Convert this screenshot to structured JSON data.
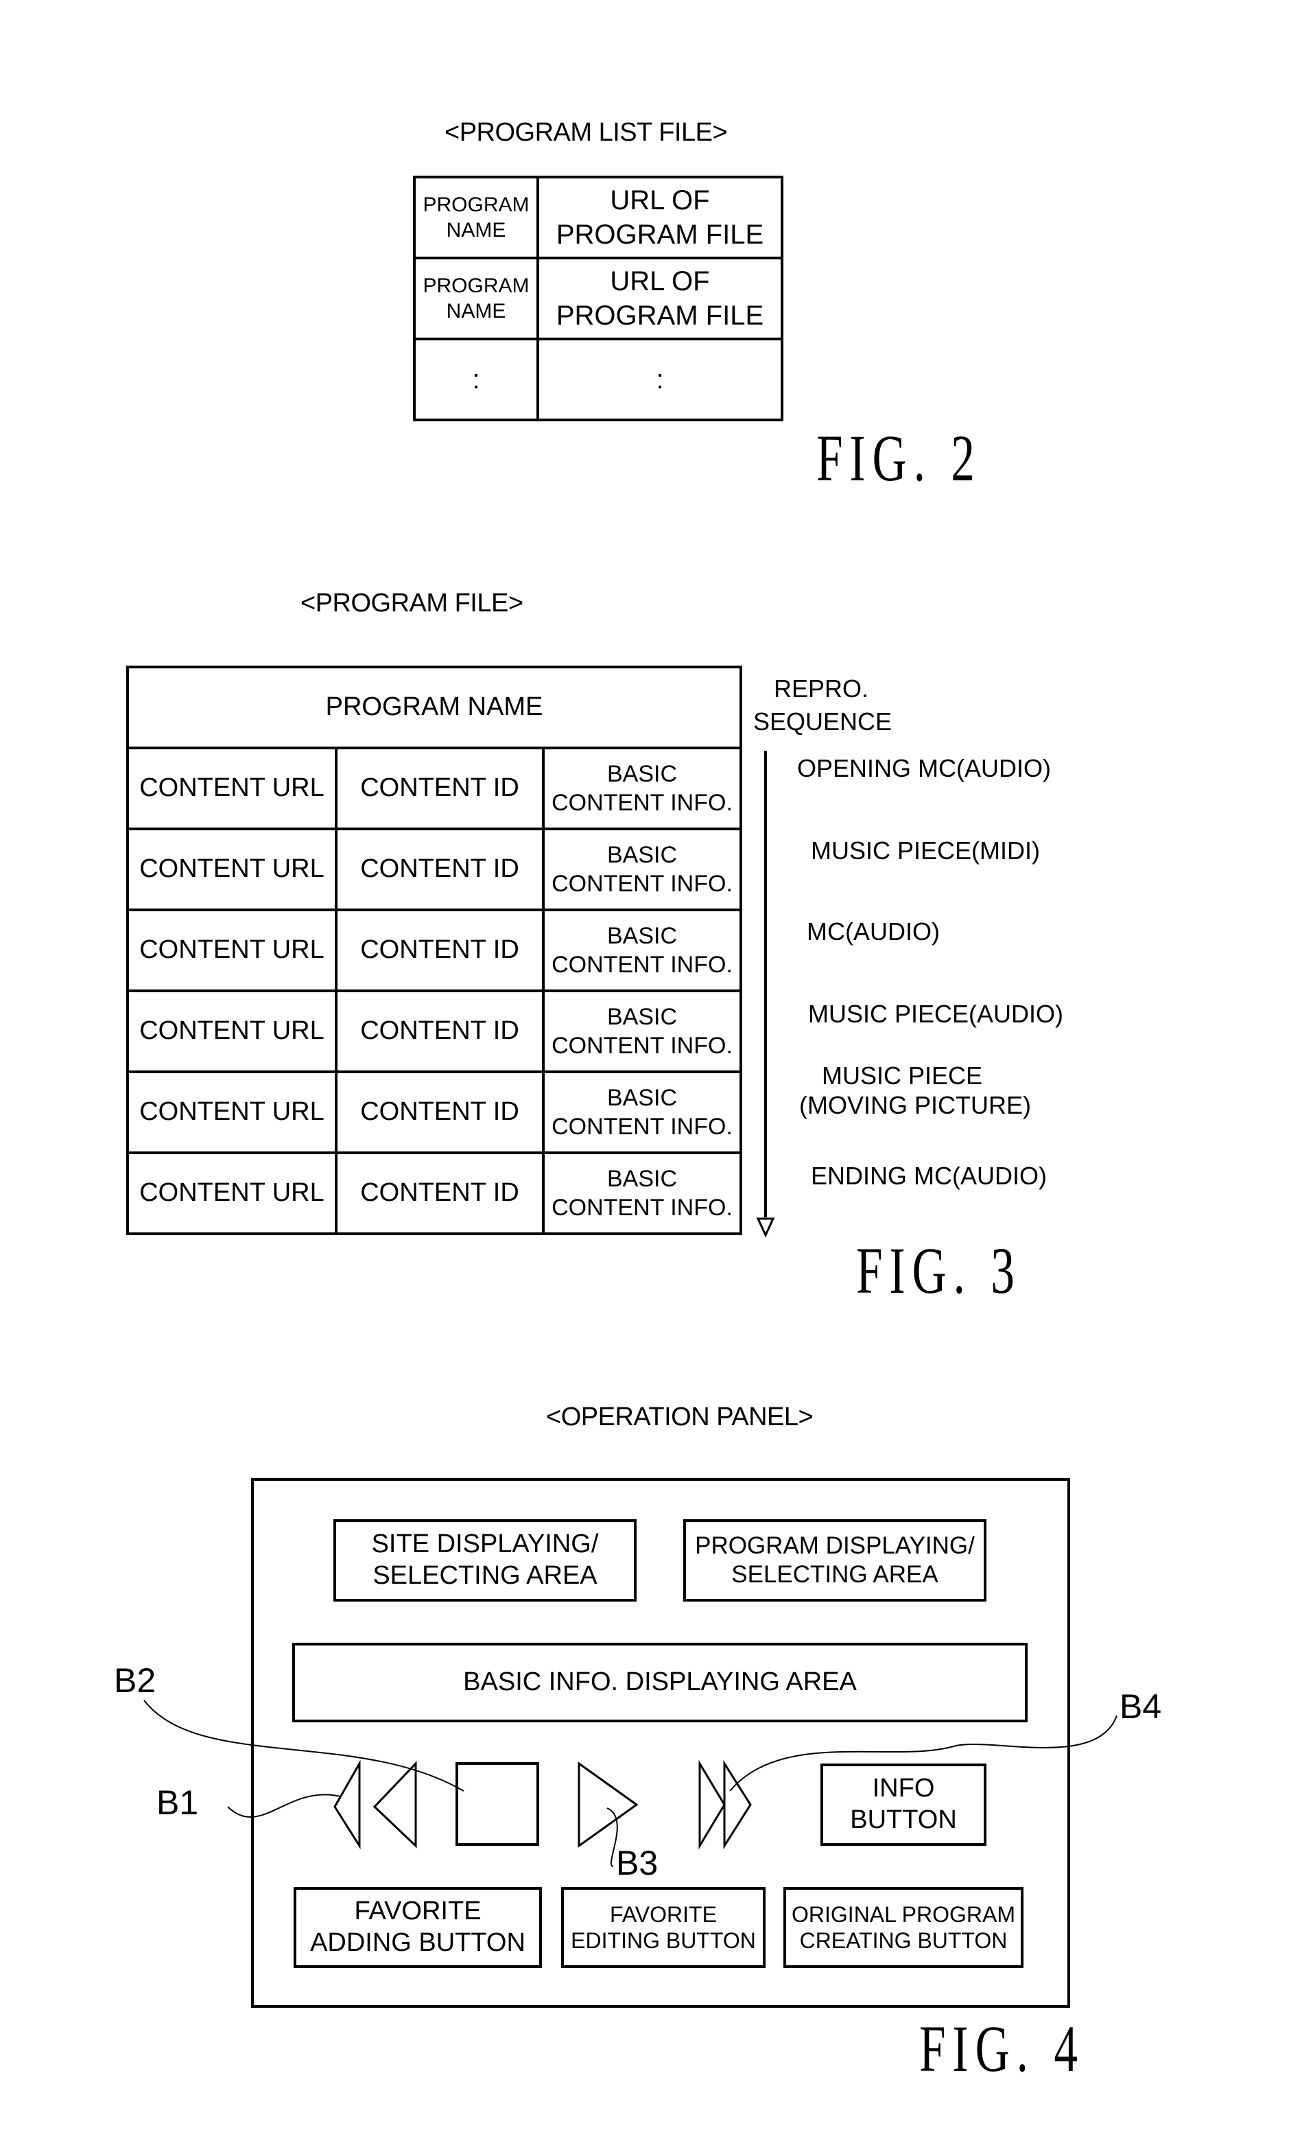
{
  "fig2": {
    "caption": "<PROGRAM LIST FILE>",
    "label": "FIG. 2",
    "rows": [
      {
        "name": "PROGRAM NAME",
        "url": "URL OF PROGRAM FILE"
      },
      {
        "name": "PROGRAM NAME",
        "url": "URL OF PROGRAM FILE"
      },
      {
        "name": ":",
        "url": ":"
      }
    ]
  },
  "fig3": {
    "caption": "<PROGRAM FILE>",
    "label": "FIG. 3",
    "header": "PROGRAM NAME",
    "rows": [
      {
        "url": "CONTENT URL",
        "id": "CONTENT ID",
        "info_line1": "BASIC",
        "info_line2": "CONTENT INFO."
      },
      {
        "url": "CONTENT URL",
        "id": "CONTENT ID",
        "info_line1": "BASIC",
        "info_line2": "CONTENT INFO."
      },
      {
        "url": "CONTENT URL",
        "id": "CONTENT ID",
        "info_line1": "BASIC",
        "info_line2": "CONTENT INFO."
      },
      {
        "url": "CONTENT URL",
        "id": "CONTENT ID",
        "info_line1": "BASIC",
        "info_line2": "CONTENT INFO."
      },
      {
        "url": "CONTENT URL",
        "id": "CONTENT ID",
        "info_line1": "BASIC",
        "info_line2": "CONTENT INFO."
      },
      {
        "url": "CONTENT URL",
        "id": "CONTENT ID",
        "info_line1": "BASIC",
        "info_line2": "CONTENT INFO."
      }
    ],
    "sequence_title_line1": "REPRO.",
    "sequence_title_line2": "SEQUENCE",
    "sequence": [
      {
        "line1": "OPENING MC(AUDIO)",
        "line2": ""
      },
      {
        "line1": "MUSIC PIECE(MIDI)",
        "line2": ""
      },
      {
        "line1": "MC(AUDIO)",
        "line2": ""
      },
      {
        "line1": "MUSIC PIECE(AUDIO)",
        "line2": ""
      },
      {
        "line1": "MUSIC PIECE",
        "line2": "(MOVING PICTURE)"
      },
      {
        "line1": "ENDING MC(AUDIO)",
        "line2": ""
      }
    ]
  },
  "fig4": {
    "caption": "<OPERATION PANEL>",
    "label": "FIG. 4",
    "site_area": {
      "line1": "SITE DISPLAYING/",
      "line2": "SELECTING AREA"
    },
    "program_area": {
      "line1": "PROGRAM DISPLAYING/",
      "line2": "SELECTING AREA"
    },
    "basic_info_area": "BASIC INFO. DISPLAYING AREA",
    "info_button": {
      "line1": "INFO",
      "line2": "BUTTON"
    },
    "favorite_adding_button": {
      "line1": "FAVORITE",
      "line2": "ADDING BUTTON"
    },
    "favorite_editing_button": {
      "line1": "FAVORITE",
      "line2": "EDITING BUTTON"
    },
    "original_program_button": {
      "line1": "ORIGINAL PROGRAM",
      "line2": "CREATING BUTTON"
    },
    "refs": {
      "b1": "B1",
      "b2": "B2",
      "b3": "B3",
      "b4": "B4"
    }
  }
}
